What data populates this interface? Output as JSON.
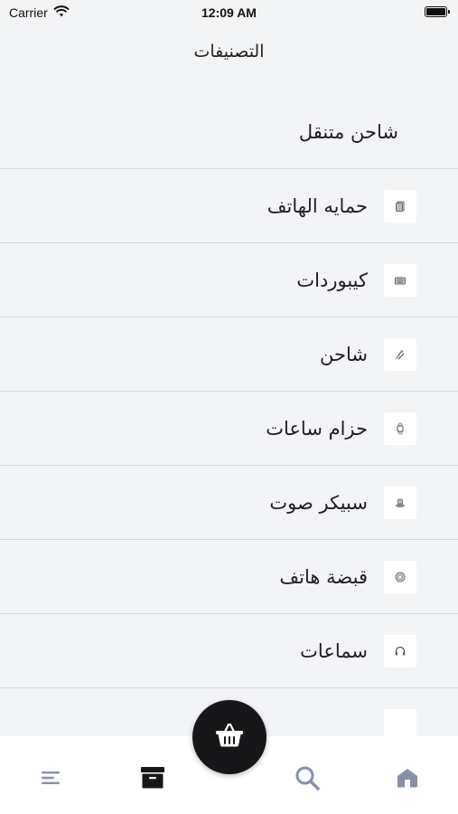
{
  "status_bar": {
    "carrier": "Carrier",
    "time": "12:09 AM"
  },
  "header": {
    "title": "التصنيفات"
  },
  "categories": [
    {
      "label": "شاحن متنقل",
      "icon": "none"
    },
    {
      "label": "حمايه الهاتف",
      "icon": "phone-case-icon"
    },
    {
      "label": "كيبوردات",
      "icon": "keyboard-icon"
    },
    {
      "label": "شاحن",
      "icon": "charger-icon"
    },
    {
      "label": "حزام ساعات",
      "icon": "watch-icon"
    },
    {
      "label": "سبيكر صوت",
      "icon": "speaker-icon"
    },
    {
      "label": "قبضة هاتف",
      "icon": "phone-grip-icon"
    },
    {
      "label": "سماعات",
      "icon": "headphones-icon"
    }
  ],
  "tabbar": {
    "items": [
      "menu-icon",
      "archive-icon",
      "search-icon",
      "home-icon"
    ],
    "fab_icon": "basket-icon",
    "active_color": "#17171a",
    "inactive_color": "#8790a6"
  }
}
